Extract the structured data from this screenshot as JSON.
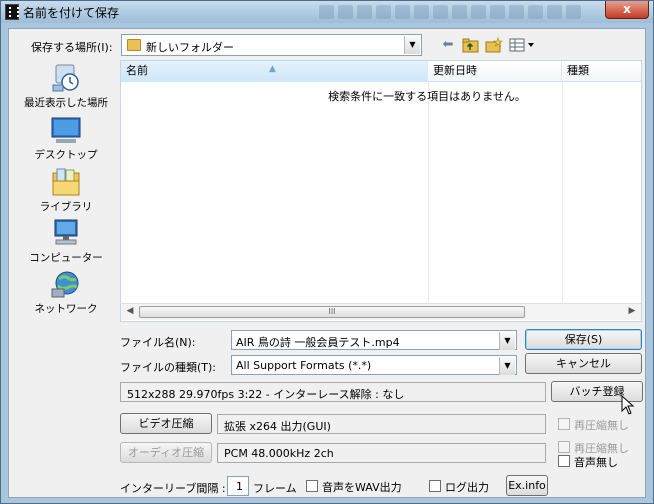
{
  "window": {
    "title": "名前を付けて保存",
    "close_label": "x"
  },
  "top": {
    "save_in_label": "保存する場所(I):",
    "save_in_value": "新しいフォルダー"
  },
  "places": [
    {
      "label": "最近表示した場所",
      "icon": "recent-places-icon"
    },
    {
      "label": "デスクトップ",
      "icon": "desktop-icon"
    },
    {
      "label": "ライブラリ",
      "icon": "libraries-icon"
    },
    {
      "label": "コンピューター",
      "icon": "computer-icon"
    },
    {
      "label": "ネットワーク",
      "icon": "network-icon"
    }
  ],
  "filelist": {
    "columns": [
      "名前",
      "更新日時",
      "種類"
    ],
    "empty_message": "検索条件に一致する項目はありません。",
    "scroll_grip": "III"
  },
  "form": {
    "filename_label": "ファイル名(N):",
    "filename_value": "AIR 鳥の詩 一般会員テスト.mp4",
    "filetype_label": "ファイルの種類(T):",
    "filetype_value": "All Support Formats (*.*)",
    "save_button": "保存(S)",
    "cancel_button": "キャンセル",
    "info_text": "512x288  29.970fps  3:22  -  インターレース解除 : なし",
    "batch_button": "バッチ登録",
    "video_button": "ビデオ圧縮",
    "video_value": "拡張 x264 出力(GUI)",
    "audio_button": "オーディオ圧縮",
    "audio_value": "PCM 48.000kHz 2ch",
    "recompress_none_1": "再圧縮無し",
    "recompress_none_2": "再圧縮無し",
    "no_audio": "音声無し",
    "interleave_label": "インターリーブ間隔 :",
    "interleave_value": "1",
    "frames_label": "フレーム",
    "wav_output": "音声をWAV出力",
    "log_output": "ログ出力",
    "exinfo_button": "Ex.info"
  }
}
